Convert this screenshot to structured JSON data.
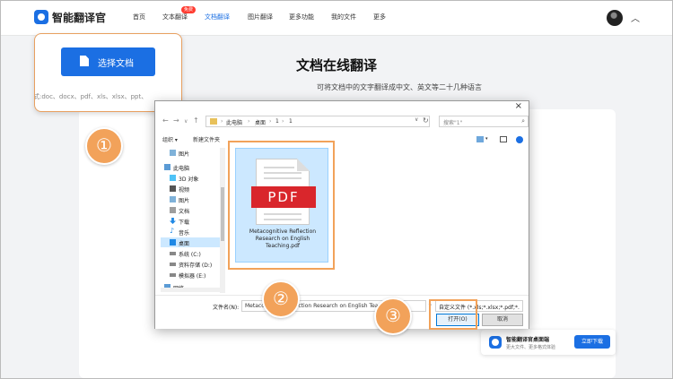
{
  "app": {
    "name": "智能翻译官"
  },
  "nav": {
    "items": [
      "首页",
      "文本翻译",
      "文档翻译",
      "图片翻译",
      "更多功能",
      "我的文件",
      "更多"
    ],
    "active": "文档翻译",
    "badge": "免费"
  },
  "page": {
    "title": "文档在线翻译",
    "subtitle": "可将文档中的文字翻译成中文、英文等二十几种语言"
  },
  "upload": {
    "button_label": "选择文档",
    "formats": "式:doc、docx、pdf、xls、xlsx、ppt、"
  },
  "steps": [
    "①",
    "②",
    "③"
  ],
  "dialog": {
    "address": {
      "segments": [
        "此电脑",
        "桌面",
        "1",
        "1"
      ]
    },
    "search_placeholder": "搜索\"1\"",
    "toolbar": {
      "organize": "组织 ▾",
      "new_folder": "新建文件夹"
    },
    "nav_items": [
      {
        "label": "图片",
        "icon": "pictures-icon"
      },
      {
        "label": "此电脑",
        "icon": "computer-icon"
      },
      {
        "label": "3D 对象",
        "icon": "3d-objects-icon"
      },
      {
        "label": "视频",
        "icon": "videos-icon"
      },
      {
        "label": "图片",
        "icon": "pictures-icon"
      },
      {
        "label": "文档",
        "icon": "documents-icon"
      },
      {
        "label": "下载",
        "icon": "downloads-icon"
      },
      {
        "label": "音乐",
        "icon": "music-icon"
      },
      {
        "label": "桌面",
        "icon": "desktop-icon",
        "selected": true
      },
      {
        "label": "系统 (C:)",
        "icon": "drive-icon"
      },
      {
        "label": "资料存储 (D:)",
        "icon": "drive-icon"
      },
      {
        "label": "模拟器 (E:)",
        "icon": "drive-icon"
      },
      {
        "label": "网络",
        "icon": "network-icon"
      }
    ],
    "file": {
      "badge_text": "PDF",
      "name": "Metacognitive Reflection Research on English Teaching.pdf"
    },
    "filename_label": "文件名(N):",
    "filename_value": "Metacognitive Reflection Research on English Teaching.pdf",
    "filter": "自定义文件 (*.xls;*.xlsx;*.pdf;*.",
    "open_label": "打开(O)",
    "cancel_label": "取消"
  },
  "download": {
    "title": "智能翻译官桌面端",
    "desc": "更大文件、更多格式体验",
    "button": "立即下载"
  },
  "colors": {
    "primary": "#1b6fe3",
    "highlight": "#f2a25a",
    "pdf_red": "#d9262c"
  }
}
